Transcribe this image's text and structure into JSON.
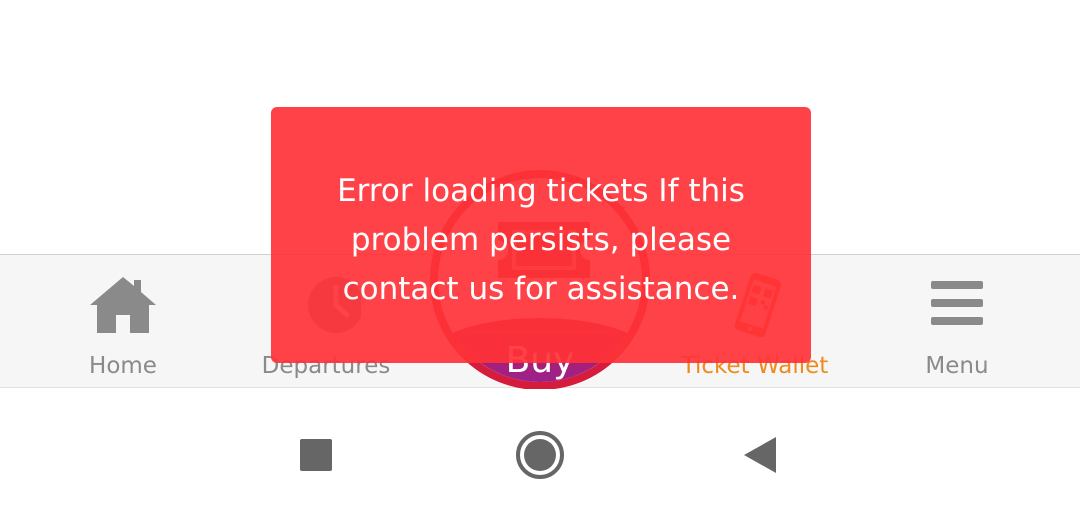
{
  "tabs": {
    "home": {
      "label": "Home",
      "icon": "home-icon"
    },
    "departures": {
      "label": "Departures",
      "icon": "clock-icon"
    },
    "buy": {
      "label": "Buy",
      "icon": "ticket-icon"
    },
    "ticket_wallet": {
      "label": "Ticket Wallet",
      "icon": "phone-qr-icon"
    },
    "menu": {
      "label": "Menu",
      "icon": "hamburger-icon"
    }
  },
  "colors": {
    "active_tab": "#f08a1c",
    "inactive_tab": "#8a8a8a",
    "toast_background": "#ff3237",
    "buy_ring": "#d51c3c",
    "buy_gradient_top": "#c01848",
    "buy_gradient_bottom": "#7a2bc8"
  },
  "error_toast": {
    "message": "Error loading tickets If this problem persists, please contact us for assistance."
  },
  "system_nav": {
    "recent_apps": "square-icon",
    "home": "circle-icon",
    "back": "triangle-back-icon"
  }
}
